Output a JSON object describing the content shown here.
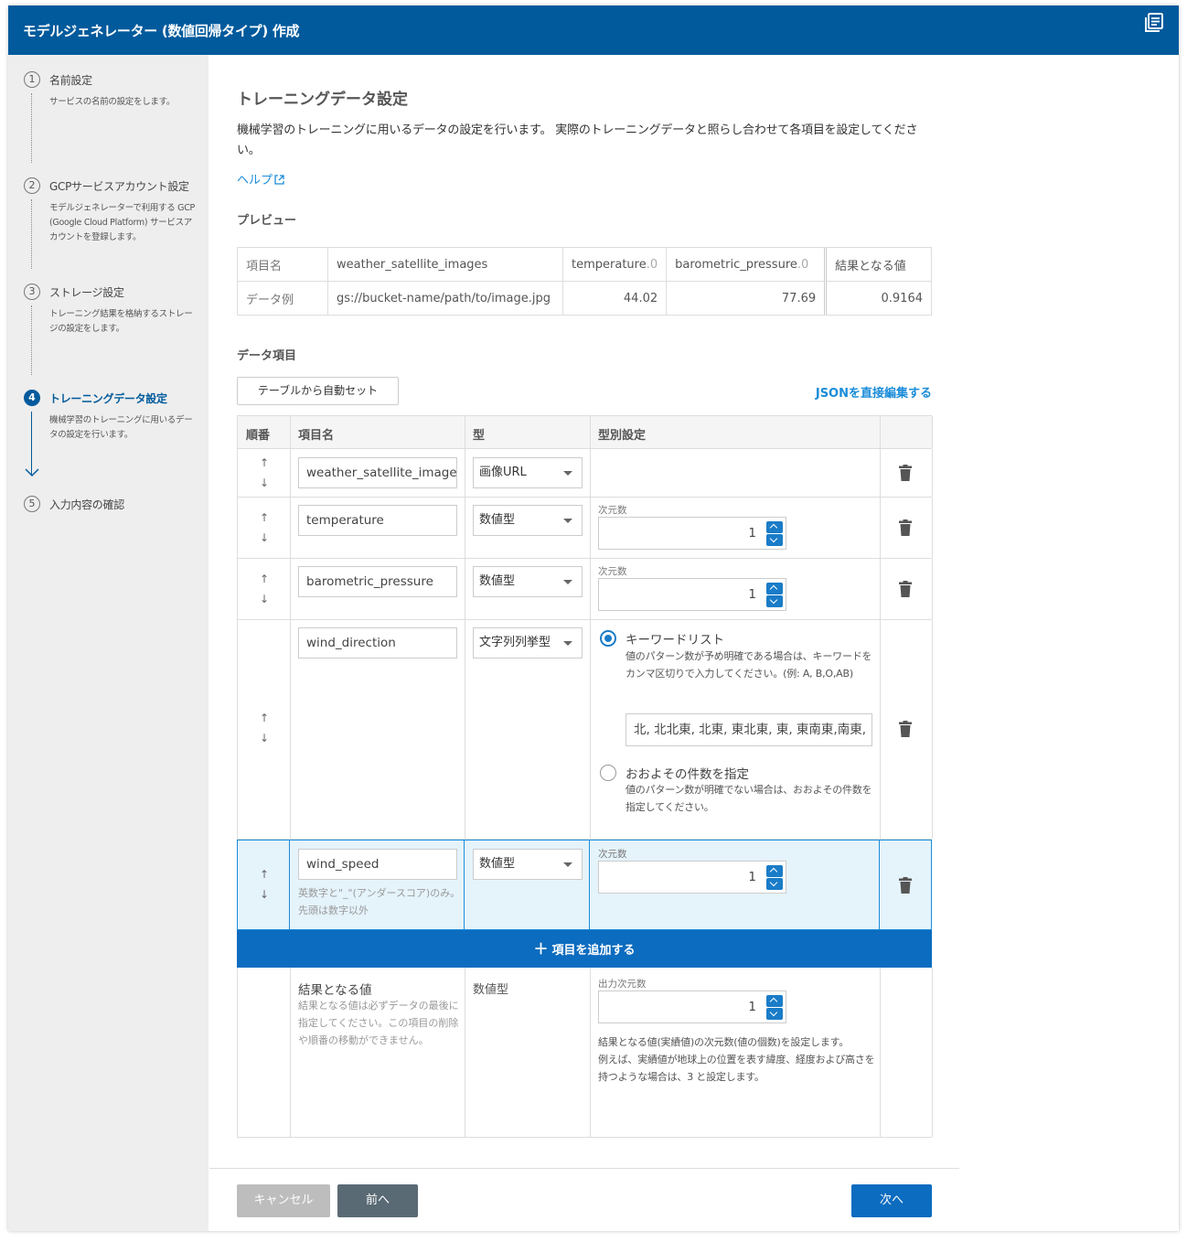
{
  "header": {
    "title": "モデルジェネレーター (数値回帰タイプ) 作成",
    "icon": "docs-icon"
  },
  "steps": [
    {
      "num": "1",
      "label": "名前設定",
      "desc": "サービスの名前の設定をします。"
    },
    {
      "num": "2",
      "label": "GCPサービスアカウント設定",
      "desc": "モデルジェネレーターで利用する GCP (Google Cloud Platform) サービスアカウントを登録します。"
    },
    {
      "num": "3",
      "label": "ストレージ設定",
      "desc": "トレーニング結果を格納するストレージの設定をします。"
    },
    {
      "num": "4",
      "label": "トレーニングデータ設定",
      "desc": "機械学習のトレーニングに用いるデータの設定を行います。"
    },
    {
      "num": "5",
      "label": "入力内容の確認",
      "desc": ""
    }
  ],
  "page": {
    "title": "トレーニングデータ設定",
    "intro": "機械学習のトレーニングに用いるデータの設定を行います。 実際のトレーニングデータと照らし合わせて各項目を設定してください。",
    "help": "ヘルプ",
    "preview_title": "プレビュー",
    "items_title": "データ項目",
    "auto_set": "テーブルから自動セット",
    "json_edit": "JSONを直接編集する"
  },
  "preview": {
    "row_labels": [
      "項目名",
      "データ例"
    ],
    "headers": [
      {
        "name": "weather_satellite_images",
        "suffix": ""
      },
      {
        "name": "temperature",
        "suffix": ".0"
      },
      {
        "name": "barometric_pressure",
        "suffix": ".0"
      },
      {
        "name": "結果となる値",
        "suffix": ""
      }
    ],
    "values": [
      "gs://bucket-name/path/to/image.jpg",
      "44.02",
      "77.69",
      "0.9164"
    ]
  },
  "items_table": {
    "headers": [
      "順番",
      "項目名",
      "型",
      "型別設定"
    ],
    "rows": [
      {
        "name": "weather_satellite_images",
        "type": "画像URL"
      },
      {
        "name": "temperature",
        "type": "数値型",
        "dim_label": "次元数",
        "dim": "1"
      },
      {
        "name": "barometric_pressure",
        "type": "数値型",
        "dim_label": "次元数",
        "dim": "1"
      },
      {
        "name": "wind_direction",
        "type": "文字列列挙型",
        "opt1_label": "キーワードリスト",
        "opt1_desc": "値のパターン数が予め明確である場合は、キーワードをカンマ区切りで入力してください。(例: A, B,O,AB)",
        "keywords": "北, 北北東, 北東, 東北東, 東, 東南東,南東,",
        "opt2_label": "おおよその件数を指定",
        "opt2_desc": "値のパターン数が明確でない場合は、おおよその件数を指定してください。"
      },
      {
        "name": "wind_speed",
        "type": "数値型",
        "dim_label": "次元数",
        "dim": "1",
        "hint": "英数字と\"_\"(アンダースコア)のみ。先頭は数字以外"
      }
    ],
    "arrows": {
      "up": "↑",
      "down": "↓"
    },
    "add_label": "項目を追加する",
    "add_icon": "＋",
    "result": {
      "title": "結果となる値",
      "desc": "結果となる値は必ずデータの最後に指定してください。この項目の削除や順番の移動ができません。",
      "type": "数値型",
      "dim_label": "出力次元数",
      "dim": "1",
      "note": "結果となる値(実績値)の次元数(値の個数)を設定します。\n例えば、実績値が地球上の位置を表す緯度、経度および高さを持つような場合は、3 と設定します。"
    }
  },
  "footer": {
    "cancel": "キャンセル",
    "prev": "前へ",
    "next": "次へ"
  },
  "colors": {
    "primary": "#005a9c",
    "accent": "#1a8cd8",
    "prev_btn": "#5a6a75",
    "cancel_btn": "#bdbdbd"
  }
}
